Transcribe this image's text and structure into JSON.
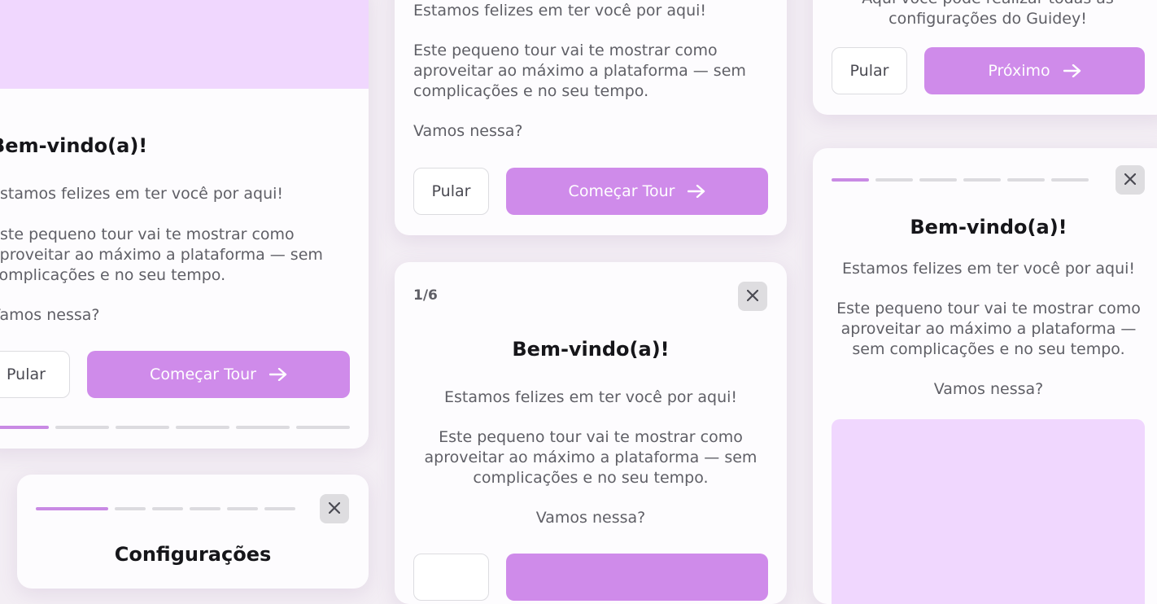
{
  "colors": {
    "background": "#f3eef4",
    "card": "#fdfcfe",
    "accent": "#cf8bea",
    "accent_light": "#f0d7fe",
    "progress_active": "#c98ae4",
    "progress_inactive": "#dcdbdf"
  },
  "card_a": {
    "title": "Bem-vindo(a)!",
    "line_1": "Estamos felizes em ter você por aqui!",
    "line_2": "Este pequeno tour vai te mostrar como aproveitar ao máximo a plataforma — sem complicações e no seu tempo.",
    "line_3": "Vamos nessa?",
    "skip_label": "Pular",
    "primary_label": "Começar Tour",
    "primary_icon": "arrow-right-icon",
    "progress": {
      "current_step": 1,
      "total_steps": 6
    }
  },
  "card_b": {
    "line_1": "Estamos felizes em ter você por aqui!",
    "line_2": "Este pequeno tour vai te mostrar como aproveitar ao máximo a plataforma — sem complicações e no seu tempo.",
    "line_3": "Vamos nessa?",
    "skip_label": "Pular",
    "primary_label": "Começar Tour",
    "primary_icon": "arrow-right-icon"
  },
  "card_c": {
    "counter": "1/6",
    "close_icon": "close-icon",
    "title": "Bem-vindo(a)!",
    "line_1": "Estamos felizes em ter você por aqui!",
    "line_2": "Este pequeno tour vai te mostrar como aproveitar ao máximo a plataforma — sem complicações e no seu tempo.",
    "line_3": "Vamos nessa?"
  },
  "card_d": {
    "close_icon": "close-icon",
    "title": "Configurações",
    "progress": {
      "current_step": 1,
      "total_steps": 6
    }
  },
  "card_e": {
    "text": "Aqui você pode realizar todas as configurações do Guidey!",
    "skip_label": "Pular",
    "primary_label": "Próximo",
    "primary_icon": "arrow-right-icon"
  },
  "card_f": {
    "close_icon": "close-icon",
    "title": "Bem-vindo(a)!",
    "line_1": "Estamos felizes em ter você por aqui!",
    "line_2": "Este pequeno tour vai te mostrar como aproveitar ao máximo a plataforma — sem complicações e no seu tempo.",
    "line_3": "Vamos nessa?",
    "progress": {
      "current_step": 1,
      "total_steps": 6
    }
  }
}
